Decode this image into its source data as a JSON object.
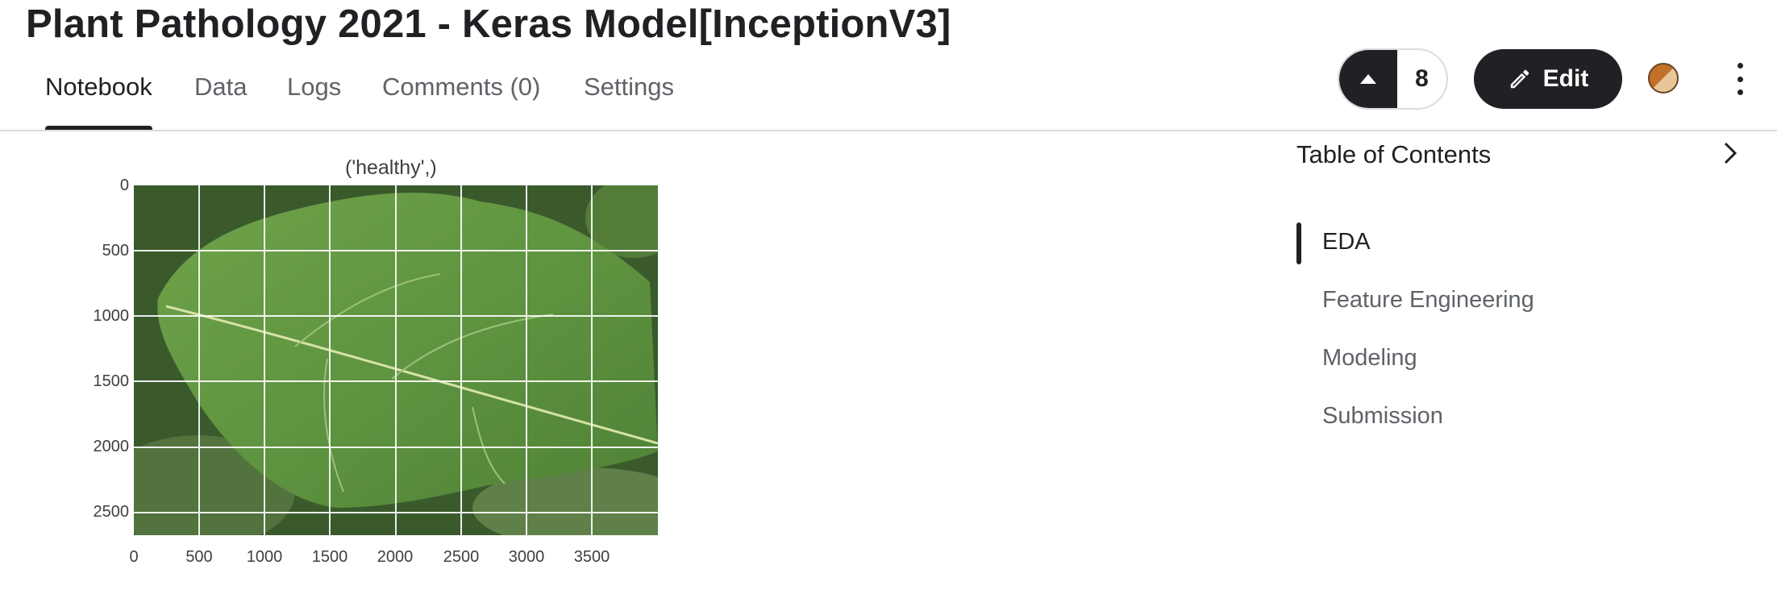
{
  "page": {
    "title": "Plant Pathology 2021 - Keras Model[InceptionV3]"
  },
  "tabs": [
    {
      "label": "Notebook",
      "active": true
    },
    {
      "label": "Data",
      "active": false
    },
    {
      "label": "Logs",
      "active": false
    },
    {
      "label": "Comments (0)",
      "active": false
    },
    {
      "label": "Settings",
      "active": false
    }
  ],
  "header_actions": {
    "vote_count": "8",
    "edit_label": "Edit",
    "icons": [
      "caret-up-icon",
      "pencil-icon",
      "avatar",
      "more-vert-icon"
    ]
  },
  "plot": {
    "title": "('healthy',)",
    "y_ticks": [
      "0",
      "500",
      "1000",
      "1500",
      "2000",
      "2500"
    ],
    "x_ticks": [
      "0",
      "500",
      "1000",
      "1500",
      "2000",
      "2500",
      "3000",
      "3500"
    ]
  },
  "toc": {
    "title": "Table of Contents",
    "items": [
      {
        "label": "EDA",
        "active": true
      },
      {
        "label": "Feature Engineering",
        "active": false
      },
      {
        "label": "Modeling",
        "active": false
      },
      {
        "label": "Submission",
        "active": false
      }
    ]
  },
  "colors": {
    "primary_dark": "#202124",
    "muted_text": "#5f6368",
    "divider": "#dadce0"
  }
}
